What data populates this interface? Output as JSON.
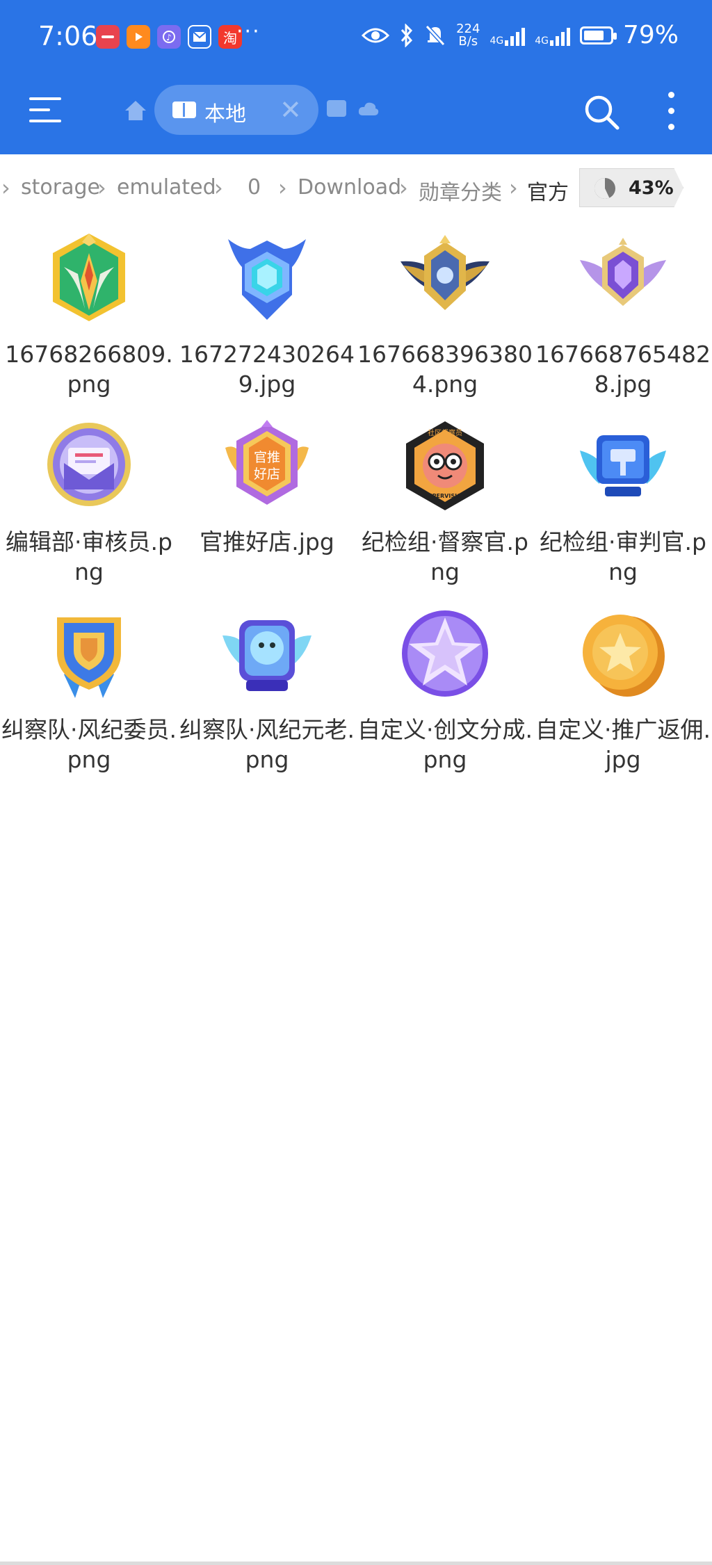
{
  "status_bar": {
    "time": "7:06",
    "notification_icons": [
      "huawei-app-icon",
      "video-app-icon",
      "music-app-icon",
      "mail-app-icon",
      "taobao-app-icon"
    ],
    "taobao_glyph": "淘",
    "more_dots": "···",
    "net_speed_value": "224",
    "net_speed_unit": "B/s",
    "network1": "4G",
    "network2": "4G",
    "battery_level": 0.79,
    "battery": "79%"
  },
  "app_bar": {
    "tab_label": "本地",
    "tab_close": "✕"
  },
  "breadcrumb": {
    "items": [
      "storage",
      "emulated",
      "0",
      "Download",
      "勋章分类",
      "官方"
    ],
    "usage_fraction": 0.43,
    "usage": "43%"
  },
  "files": [
    {
      "name": "16768266809.png",
      "icon": "green-gold-winged-badge-icon"
    },
    {
      "name": "1672724302649.jpg",
      "icon": "blue-crystal-horned-badge-icon"
    },
    {
      "name": "1676683963804.png",
      "icon": "gold-winged-emblem-icon"
    },
    {
      "name": "1676687654828.jpg",
      "icon": "purple-crystal-winged-badge-icon"
    },
    {
      "name": "编辑部·审核员.png",
      "icon": "purple-envelope-badge-icon"
    },
    {
      "name": "官推好店.jpg",
      "icon": "orange-hexagon-shop-badge-icon"
    },
    {
      "name": "纪检组·督察官.png",
      "icon": "monkey-supervision-badge-icon",
      "badge_texts": [
        "社区督察员",
        "SUPERVISION"
      ]
    },
    {
      "name": "纪检组·审判官.png",
      "icon": "blue-hammer-badge-icon"
    },
    {
      "name": "纠察队·风纪委员.png",
      "icon": "gold-shield-ribbon-badge-icon"
    },
    {
      "name": "纠察队·风纪元老.png",
      "icon": "blue-dog-winged-badge-icon"
    },
    {
      "name": "自定义·创文分成.png",
      "icon": "purple-star-orb-icon"
    },
    {
      "name": "自定义·推广返佣.jpg",
      "icon": "gold-star-coin-icon"
    }
  ],
  "badge_text": {
    "shop_line1": "官推",
    "shop_line2": "好店"
  },
  "colors": {
    "primary": "#2a74e6",
    "tab_bg": "#5a95ee",
    "text": "#333333",
    "crumb": "#8a8a8a"
  }
}
